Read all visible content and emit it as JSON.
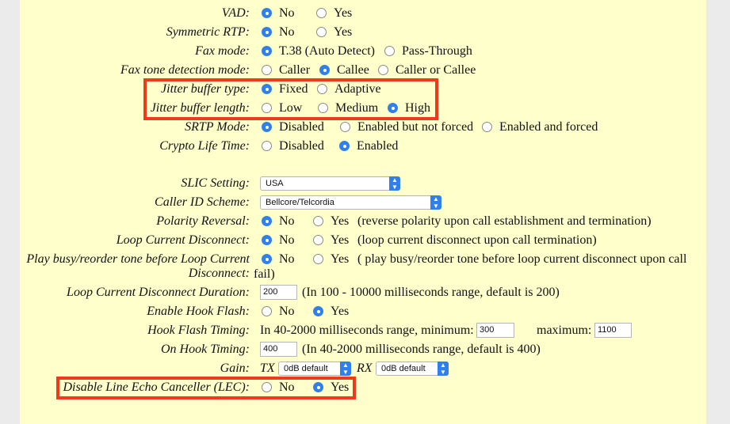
{
  "rows": {
    "vad": {
      "label": "VAD:",
      "opts": [
        "No",
        "Yes"
      ],
      "selected": "No"
    },
    "symrtp": {
      "label": "Symmetric RTP:",
      "opts": [
        "No",
        "Yes"
      ],
      "selected": "No"
    },
    "faxmode": {
      "label": "Fax mode:",
      "opts": [
        "T.38 (Auto Detect)",
        "Pass-Through"
      ],
      "selected": "T.38 (Auto Detect)"
    },
    "faxtone": {
      "label": "Fax tone detection mode:",
      "opts": [
        "Caller",
        "Callee",
        "Caller or Callee"
      ],
      "selected": "Callee"
    },
    "jbtype": {
      "label": "Jitter buffer type:",
      "opts": [
        "Fixed",
        "Adaptive"
      ],
      "selected": "Fixed"
    },
    "jblen": {
      "label": "Jitter buffer length:",
      "opts": [
        "Low",
        "Medium",
        "High"
      ],
      "selected": "High"
    },
    "srtp": {
      "label": "SRTP Mode:",
      "opts": [
        "Disabled",
        "Enabled but not forced",
        "Enabled and forced"
      ],
      "selected": "Disabled"
    },
    "crypto": {
      "label": "Crypto Life Time:",
      "opts": [
        "Disabled",
        "Enabled"
      ],
      "selected": "Enabled"
    },
    "slic": {
      "label": "SLIC Setting:",
      "value": "USA"
    },
    "callerid": {
      "label": "Caller ID Scheme:",
      "value": "Bellcore/Telcordia"
    },
    "polarity": {
      "label": "Polarity Reversal:",
      "opts": [
        "No",
        "Yes"
      ],
      "selected": "No",
      "note": "(reverse polarity upon call establishment and termination)"
    },
    "loopdisc": {
      "label": "Loop Current Disconnect:",
      "opts": [
        "No",
        "Yes"
      ],
      "selected": "No",
      "note": "(loop current disconnect upon call termination)"
    },
    "playbusy": {
      "label_line1": "Play busy/reorder tone before Loop Current",
      "label_line2": "Disconnect:",
      "opts": [
        "No",
        "Yes"
      ],
      "selected": "No",
      "note_line1": "( play busy/reorder tone before loop current disconnect upon call",
      "note_line2": "fail)"
    },
    "loopdur": {
      "label": "Loop Current Disconnect Duration:",
      "value": "200",
      "note": "(In 100 - 10000 milliseconds range, default is 200)"
    },
    "hookflash": {
      "label": "Enable Hook Flash:",
      "opts": [
        "No",
        "Yes"
      ],
      "selected": "Yes"
    },
    "hooktiming": {
      "label": "Hook Flash Timing:",
      "prefix": "In 40-2000 milliseconds range, minimum:",
      "min": "300",
      "max_label": "maximum:",
      "max": "1100"
    },
    "onhook": {
      "label": "On Hook Timing:",
      "value": "400",
      "note": "(In 40-2000 milliseconds range, default is 400)"
    },
    "gain": {
      "label": "Gain:",
      "tx_label": "TX",
      "tx": "0dB default",
      "rx_label": "RX",
      "rx": "0dB default"
    },
    "lec": {
      "label": "Disable Line Echo Canceller (LEC):",
      "opts": [
        "No",
        "Yes"
      ],
      "selected": "Yes"
    }
  },
  "colors": {
    "panel": "#ffffcc",
    "highlight": "#ee3b1d",
    "accent": "#2f80ed"
  }
}
